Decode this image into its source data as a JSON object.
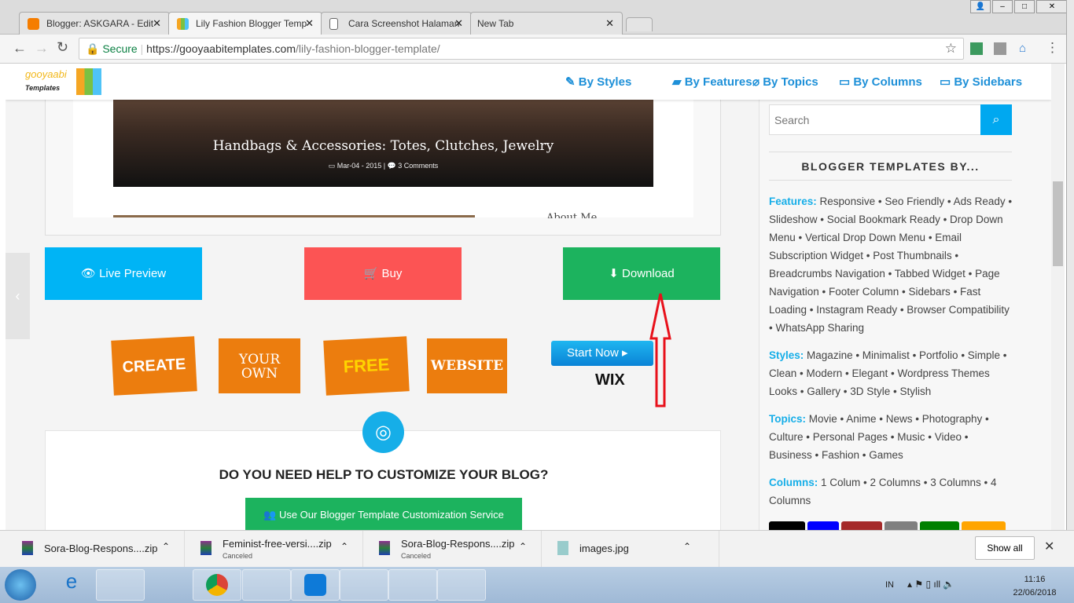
{
  "browser": {
    "tabs": [
      {
        "title": "Blogger: ASKGARA - Edit",
        "icon": "blogger-icon"
      },
      {
        "title": "Lily Fashion Blogger Temp",
        "icon": "gooyaabi-icon",
        "active": true
      },
      {
        "title": "Cara Screenshot Halaman",
        "icon": "page-icon"
      },
      {
        "title": "New Tab"
      }
    ],
    "secure_label": "Secure",
    "url_host": "https://gooyaabitemplates.com",
    "url_path": "/lily-fashion-blogger-template/"
  },
  "site": {
    "logo_text": "gooyaabi Templates",
    "nav": [
      "By Styles",
      "By Features",
      "By Topics",
      "By Columns",
      "By Sidebars"
    ],
    "post": {
      "title": "Handbags & Accessories: Totes, Clutches, Jewelry",
      "date": "Mar-04 - 2015",
      "comments": "3 Comments",
      "next_heading": "About Me"
    },
    "buttons": {
      "live_preview": "Live Preview",
      "buy": "Buy",
      "download": "Download"
    },
    "ad": {
      "words": [
        "CREATE",
        "YOUR OWN",
        "FREE",
        "WEBSITE"
      ],
      "cta": "Start Now",
      "brand": "WIX"
    },
    "help": {
      "title": "DO YOU NEED HELP TO CUSTOMIZE YOUR BLOG?",
      "button": "Use Our Blogger Template Customization Service"
    },
    "sidebar": {
      "search_placeholder": "Search",
      "heading": "BLOGGER TEMPLATES BY...",
      "groups": [
        {
          "label": "Features:",
          "text": "Responsive • Seo Friendly • Ads Ready • Slideshow • Social Bookmark Ready • Drop Down Menu • Vertical Drop Down Menu • Email Subscription Widget • Post Thumbnails • Breadcrumbs Navigation • Tabbed Widget • Page Navigation • Footer Column • Sidebars • Fast Loading • Instagram Ready • Browser Compatibility • WhatsApp Sharing"
        },
        {
          "label": "Styles:",
          "text": "Magazine • Minimalist • Portfolio • Simple • Clean • Modern • Elegant • Wordpress Themes Looks • Gallery • 3D Style • Stylish"
        },
        {
          "label": "Topics:",
          "text": "Movie • Anime • News • Photography • Culture • Personal Pages • Music • Video • Business • Fashion • Games"
        },
        {
          "label": "Columns:",
          "text": "1 Colum • 2 Columns • 3 Columns • 4 Columns"
        }
      ],
      "swatches": [
        "#000000",
        "#0000ff",
        "#a52a2a",
        "#808080",
        "#008000",
        "#ffa500"
      ]
    }
  },
  "downloads": {
    "items": [
      {
        "name": "Sora-Blog-Respons....zip",
        "status": ""
      },
      {
        "name": "Feminist-free-versi....zip",
        "status": "Canceled"
      },
      {
        "name": "Sora-Blog-Respons....zip",
        "status": "Canceled"
      },
      {
        "name": "images.jpg",
        "status": ""
      }
    ],
    "show_all": "Show all"
  },
  "taskbar": {
    "lang": "IN",
    "time": "11:16",
    "date": "22/06/2018"
  },
  "colors": {
    "live_preview": "#00b4f5",
    "buy": "#fc5454",
    "download": "#1cb35e",
    "accent": "#16aee8"
  }
}
